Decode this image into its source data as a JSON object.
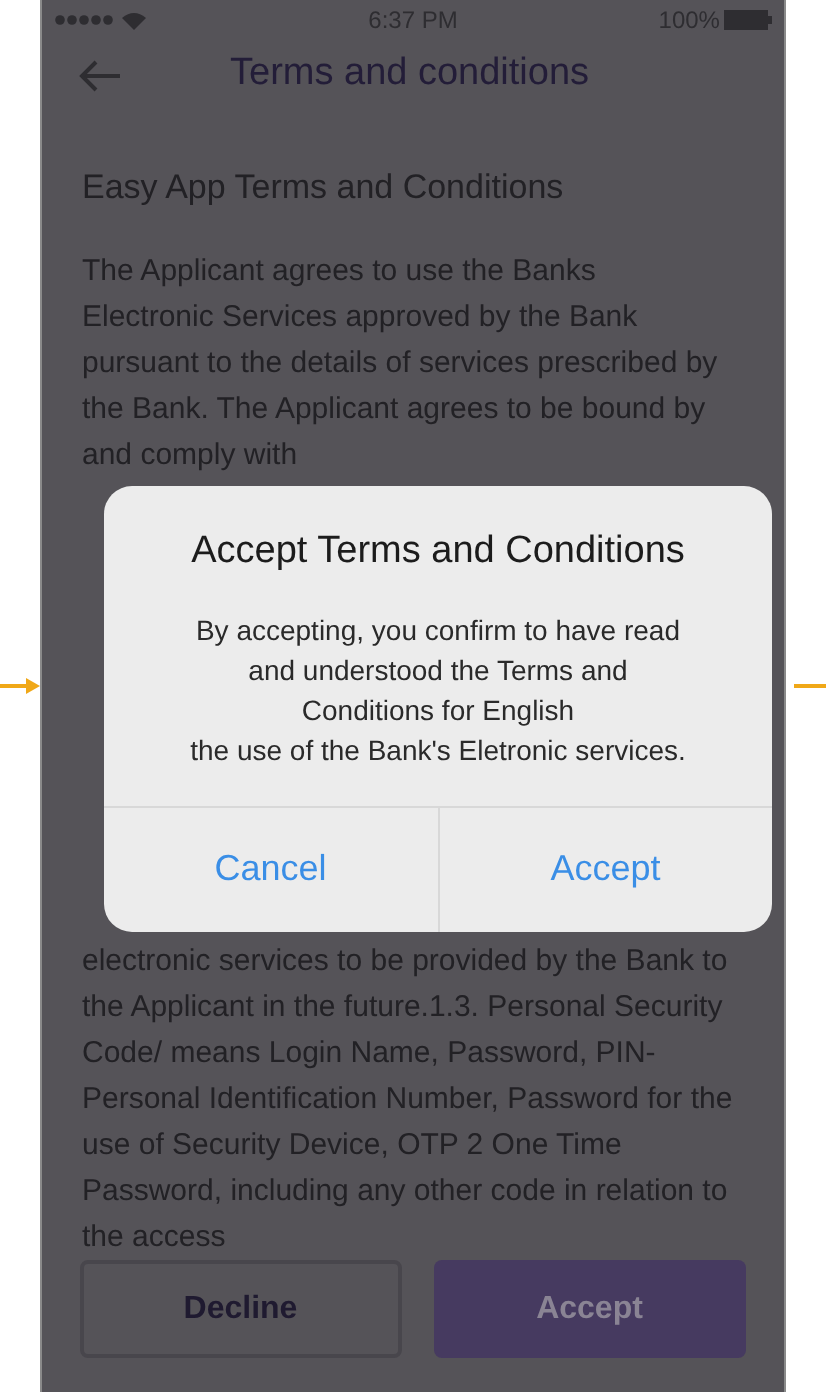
{
  "status_bar": {
    "time": "6:37 PM",
    "battery": "100%"
  },
  "header": {
    "title": "Terms and conditions"
  },
  "content": {
    "heading": "Easy App Terms and Conditions",
    "paragraphs": [
      "The Applicant agrees to use the Banks Electronic Services approved by the Bank pursuant to the details of services prescribed by the Bank. The Applicant agrees to be bound by and comply with",
      "electronic services to be provided by the Bank to the Applicant in the future.1.3. Personal Security Code/ means Login Name, Password, PIN-Personal Identification Number, Password for the use of Security Device, OTP 2 One Time Password, including any other code in relation to the access"
    ]
  },
  "footer_buttons": [
    {
      "label": "Decline",
      "kind": "outline"
    },
    {
      "label": "Accept",
      "kind": "filled"
    }
  ],
  "dialog": {
    "title": "Accept Terms and Conditions",
    "message_lines": [
      "By accepting, you confirm to have read",
      "and understood the Terms and",
      "Conditions for English",
      "the use of the Bank's Eletronic services."
    ],
    "buttons": [
      "Cancel",
      "Accept"
    ]
  }
}
